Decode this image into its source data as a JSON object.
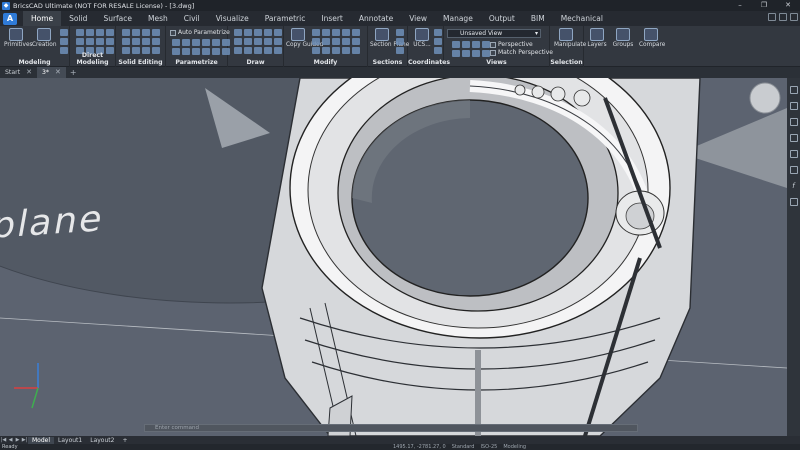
{
  "window": {
    "title": "BricsCAD Ultimate (NOT FOR RESALE License) - [3.dwg]",
    "controls": [
      "–",
      "❐",
      "✕"
    ]
  },
  "app_button": "A",
  "ribbon_tabs": [
    "Home",
    "Solid",
    "Surface",
    "Mesh",
    "Civil",
    "Visualize",
    "Parametric",
    "Insert",
    "Annotate",
    "View",
    "Manage",
    "Output",
    "BIM",
    "Mechanical"
  ],
  "active_ribbon_tab": "Home",
  "ribbon": {
    "modeling": {
      "label": "Modeling",
      "primitives": "Primitives",
      "creation": "Creation"
    },
    "direct_modeling": {
      "label": "Direct Modeling"
    },
    "solid_editing": {
      "label": "Solid Editing"
    },
    "parametrize": {
      "label": "Parametrize",
      "auto": "Auto Parametrize"
    },
    "draw": {
      "label": "Draw"
    },
    "modify": {
      "label": "Modify",
      "copy_guided": "Copy Guided"
    },
    "sections": {
      "label": "Sections",
      "section_plane": "Section Plane"
    },
    "coordinates": {
      "label": "Coordinates",
      "ucs": "UCS..."
    },
    "views": {
      "label": "Views",
      "combo_value": "Unsaved View",
      "perspective": "Perspective",
      "match_perspective": "Match Perspective"
    },
    "selection": {
      "label": "Selection",
      "manipulate": "Manipulate"
    },
    "layers": {
      "label": "Layers"
    },
    "groups": {
      "label": "Groups"
    },
    "compare": {
      "label": "Compare"
    }
  },
  "doc_tabs": [
    {
      "label": "Start",
      "close": "✕"
    },
    {
      "label": "3*",
      "close": "✕"
    }
  ],
  "doc_tab_add": "+",
  "viewport": {
    "plane_label": "plane"
  },
  "command_line": {
    "placeholder": "Enter command"
  },
  "layout_tabs": [
    "Model",
    "Layout1",
    "Layout2"
  ],
  "layout_add": "+",
  "layout_nav": [
    "|◀",
    "◀",
    "▶",
    "▶|"
  ],
  "status": {
    "ready": "Ready",
    "coords": "1495.17, -2781.27, 0",
    "style": "Standard",
    "iso": "ISO-25",
    "workspace": "Modeling"
  }
}
